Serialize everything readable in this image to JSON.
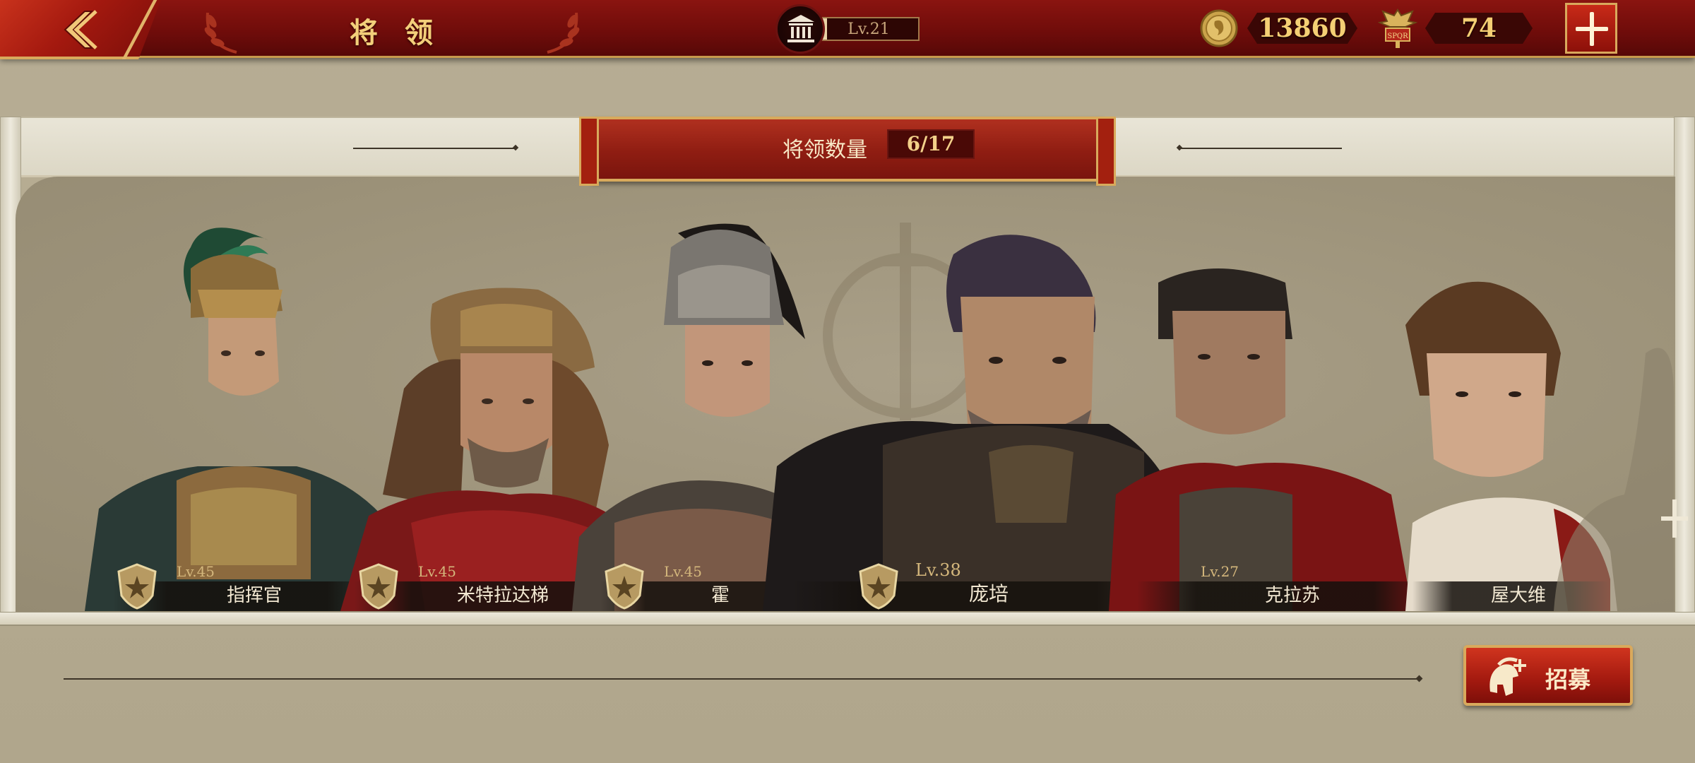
{
  "header": {
    "title": "将 领",
    "city_level": "Lv.21",
    "city_level_progress": 0.08,
    "gold": "13860",
    "tokens": "74",
    "icons": {
      "back": "back-chevron-icon",
      "city": "temple-icon",
      "gold": "gold-coin-icon",
      "token": "spqr-eagle-icon",
      "add": "plus-icon"
    }
  },
  "roster": {
    "label": "将领数量",
    "count": "6/17"
  },
  "generals": [
    {
      "level": "Lv.45",
      "name": "指挥官"
    },
    {
      "level": "Lv.45",
      "name": "米特拉达梯"
    },
    {
      "level": "Lv.45",
      "name": "霍"
    },
    {
      "level": "Lv.38",
      "name": "庞培"
    },
    {
      "level": "Lv.27",
      "name": "克拉苏"
    },
    {
      "level": "",
      "name": "屋大维"
    }
  ],
  "recruit": {
    "label": "招募",
    "icon": "helmet-plus-icon"
  },
  "colors": {
    "primary_red": "#8a1410",
    "gold_text": "#f3cf7a",
    "panel_bg": "#b7ad94"
  }
}
